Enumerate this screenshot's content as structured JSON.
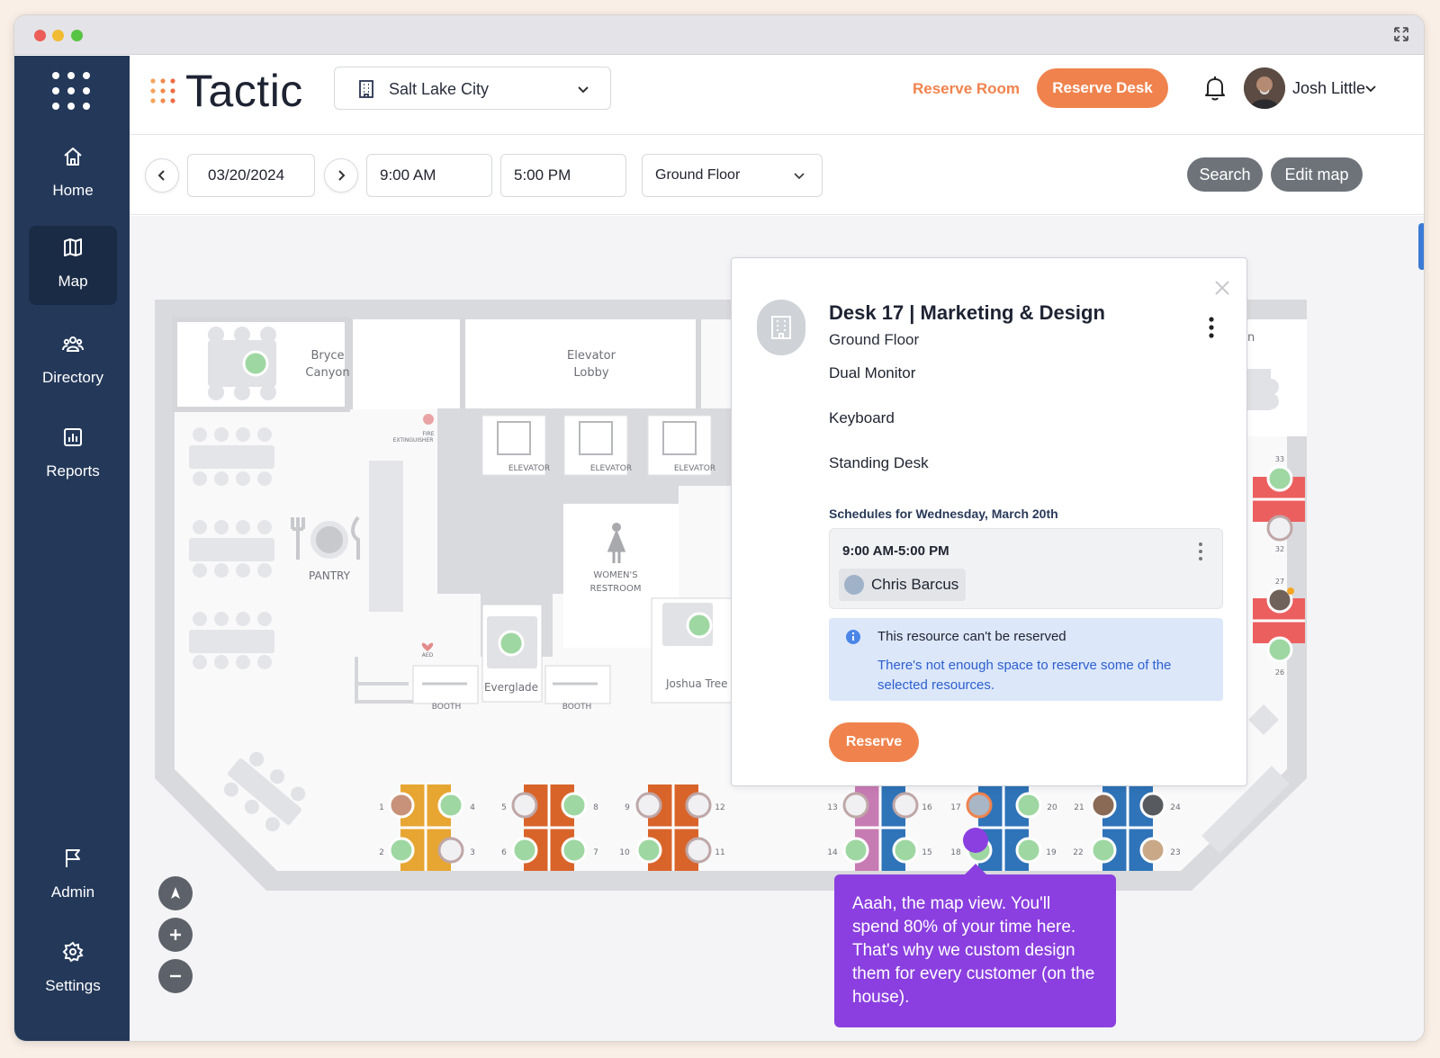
{
  "window": {
    "dots": [
      "#ec5e57",
      "#f2bb34",
      "#58c443"
    ]
  },
  "sidebar": {
    "items": [
      {
        "label": "Home",
        "icon": "home-icon"
      },
      {
        "label": "Map",
        "icon": "map-icon",
        "active": true
      },
      {
        "label": "Directory",
        "icon": "people-icon"
      },
      {
        "label": "Reports",
        "icon": "chart-icon"
      },
      {
        "label": "Admin",
        "icon": "flag-icon"
      },
      {
        "label": "Settings",
        "icon": "gear-icon"
      }
    ]
  },
  "header": {
    "brand": "Tactic",
    "location": "Salt Lake City",
    "reserve_room": "Reserve Room",
    "reserve_desk": "Reserve Desk",
    "user_name": "Josh Little",
    "accent": "#f0834d"
  },
  "toolbar": {
    "date": "03/20/2024",
    "start_time": "9:00 AM",
    "end_time": "5:00 PM",
    "floor": "Ground Floor",
    "search": "Search",
    "edit_map": "Edit map"
  },
  "map": {
    "rooms": {
      "bryce": [
        "Bryce",
        "Canyon"
      ],
      "elevator_lobby": [
        "Elevator",
        "Lobby"
      ],
      "pantry": "PANTRY",
      "womens": [
        "WOMEN'S",
        "RESTROOM"
      ],
      "everglade": "Everglade",
      "joshua": "Joshua Tree",
      "booth": "BOOTH",
      "elevator": "ELEVATOR",
      "fire": [
        "FIRE",
        "EXTINGUISHER"
      ],
      "aed": "AED",
      "partial_n": "n"
    },
    "desk_numbers": [
      "1",
      "2",
      "3",
      "4",
      "5",
      "6",
      "7",
      "8",
      "9",
      "10",
      "11",
      "12",
      "13",
      "14",
      "15",
      "16",
      "17",
      "18",
      "19",
      "20",
      "21",
      "22",
      "23",
      "24",
      "26",
      "27",
      "32",
      "33"
    ]
  },
  "popup": {
    "title": "Desk 17 | Marketing & Design",
    "subtitle": "Ground Floor",
    "features": [
      "Dual Monitor",
      "Keyboard",
      "Standing Desk"
    ],
    "schedule_heading": "Schedules for Wednesday, March 20th",
    "schedule_time": "9:00 AM-5:00 PM",
    "schedule_person": "Chris Barcus",
    "info_title": "This resource can't be reserved",
    "info_body": "There's not enough space to reserve some of the selected resources.",
    "reserve": "Reserve"
  },
  "tooltip": {
    "text": "Aaah, the map view. You'll spend 80% of your time here. That's why we custom design them for every customer (on the house)."
  }
}
